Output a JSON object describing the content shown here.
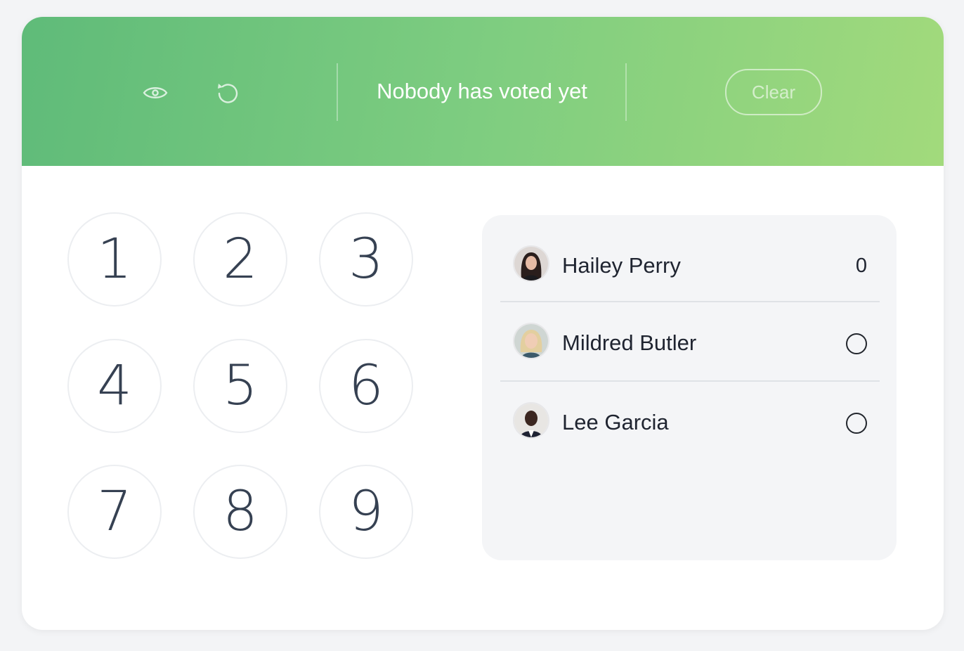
{
  "header": {
    "status": "Nobody has voted yet",
    "clear_label": "Clear",
    "icons": [
      "eye-icon",
      "reset-icon"
    ],
    "gradient": [
      "#5fbb79",
      "#a2da7c"
    ]
  },
  "keypad": {
    "keys": [
      "1",
      "2",
      "3",
      "4",
      "5",
      "6",
      "7",
      "8",
      "9"
    ]
  },
  "voters": [
    {
      "name": "Hailey Perry",
      "vote": "0",
      "avatar_icon": "avatar-hailey-perry"
    },
    {
      "name": "Mildred Butler",
      "vote": null,
      "status_icon": "not-voted-circle-icon",
      "avatar_icon": "avatar-mildred-butler"
    },
    {
      "name": "Lee Garcia",
      "vote": null,
      "status_icon": "not-voted-circle-icon",
      "avatar_icon": "avatar-lee-garcia"
    }
  ]
}
